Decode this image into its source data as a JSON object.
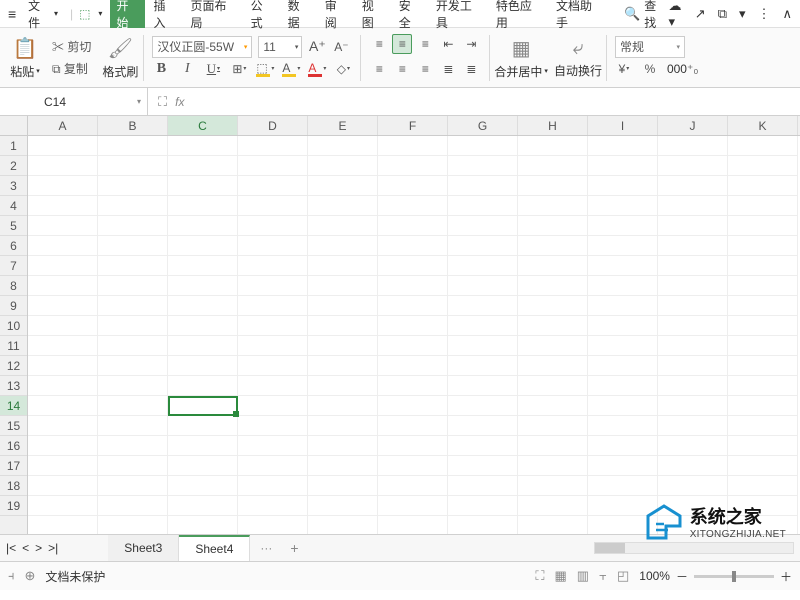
{
  "menu": {
    "file": "文件",
    "tabs": [
      "开始",
      "插入",
      "页面布局",
      "公式",
      "数据",
      "审阅",
      "视图",
      "安全",
      "开发工具",
      "特色应用",
      "文档助手"
    ],
    "activeTab": 0,
    "search": "查找"
  },
  "ribbon": {
    "paste": "粘贴",
    "cut": "剪切",
    "copy": "复制",
    "formatPainter": "格式刷",
    "fontName": "汉仪正圆-55W",
    "fontSize": "11",
    "mergeCenter": "合并居中",
    "autoWrap": "自动换行",
    "general": "常规",
    "increaseFont": "A⁺",
    "decreaseFont": "A⁻"
  },
  "formula": {
    "cellRef": "C14",
    "fx": "fx"
  },
  "grid": {
    "columns": [
      "A",
      "B",
      "C",
      "D",
      "E",
      "F",
      "G",
      "H",
      "I",
      "J",
      "K"
    ],
    "rows": [
      "1",
      "2",
      "3",
      "4",
      "5",
      "6",
      "7",
      "8",
      "9",
      "10",
      "11",
      "12",
      "13",
      "14",
      "15",
      "16",
      "17",
      "18",
      "19"
    ],
    "activeCol": 2,
    "activeRow": 13
  },
  "sheets": {
    "list": [
      "Sheet3",
      "Sheet4"
    ],
    "active": 1,
    "more": "···"
  },
  "status": {
    "docProtect": "文档未保护",
    "zoom": "100%"
  },
  "watermark": {
    "cn": "系统之家",
    "en": "XITONGZHIJIA.NET"
  }
}
